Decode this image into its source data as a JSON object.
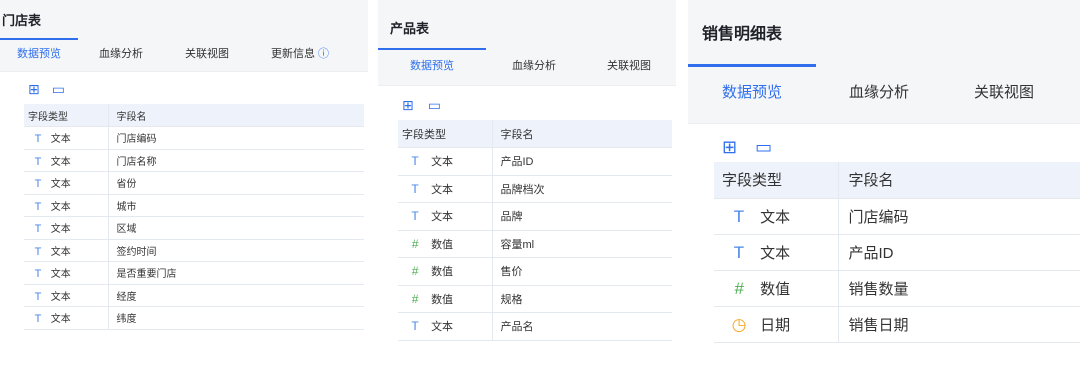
{
  "colors": {
    "accent": "#2f6fed",
    "text_icon": "#4a86e8",
    "number_icon": "#4caf50",
    "date_icon": "#f5a623"
  },
  "icons": {
    "grid": "grid-icon",
    "window": "window-icon",
    "info": "info-icon",
    "text": "T",
    "number": "#",
    "date": "◷"
  },
  "panels": [
    {
      "title": "门店表",
      "tabs": [
        "数据预览",
        "血缘分析",
        "关联视图",
        "更新信息"
      ],
      "active_tab": 0,
      "columns": [
        "字段类型",
        "字段名"
      ],
      "rows": [
        {
          "type": "文本",
          "name": "门店编码"
        },
        {
          "type": "文本",
          "name": "门店名称"
        },
        {
          "type": "文本",
          "name": "省份"
        },
        {
          "type": "文本",
          "name": "城市"
        },
        {
          "type": "文本",
          "name": "区域"
        },
        {
          "type": "文本",
          "name": "签约时间"
        },
        {
          "type": "文本",
          "name": "是否重要门店"
        },
        {
          "type": "文本",
          "name": "经度"
        },
        {
          "type": "文本",
          "name": "纬度"
        }
      ]
    },
    {
      "title": "产品表",
      "tabs": [
        "数据预览",
        "血缘分析",
        "关联视图"
      ],
      "active_tab": 0,
      "columns": [
        "字段类型",
        "字段名"
      ],
      "rows": [
        {
          "type": "文本",
          "name": "产品ID"
        },
        {
          "type": "文本",
          "name": "品牌档次"
        },
        {
          "type": "文本",
          "name": "品牌"
        },
        {
          "type": "数值",
          "name": "容量ml"
        },
        {
          "type": "数值",
          "name": "售价"
        },
        {
          "type": "数值",
          "name": "规格"
        },
        {
          "type": "文本",
          "name": "产品名"
        }
      ]
    },
    {
      "title": "销售明细表",
      "tabs": [
        "数据预览",
        "血缘分析",
        "关联视图"
      ],
      "active_tab": 0,
      "columns": [
        "字段类型",
        "字段名"
      ],
      "rows": [
        {
          "type": "文本",
          "name": "门店编码"
        },
        {
          "type": "文本",
          "name": "产品ID"
        },
        {
          "type": "数值",
          "name": "销售数量"
        },
        {
          "type": "日期",
          "name": "销售日期"
        }
      ]
    }
  ]
}
